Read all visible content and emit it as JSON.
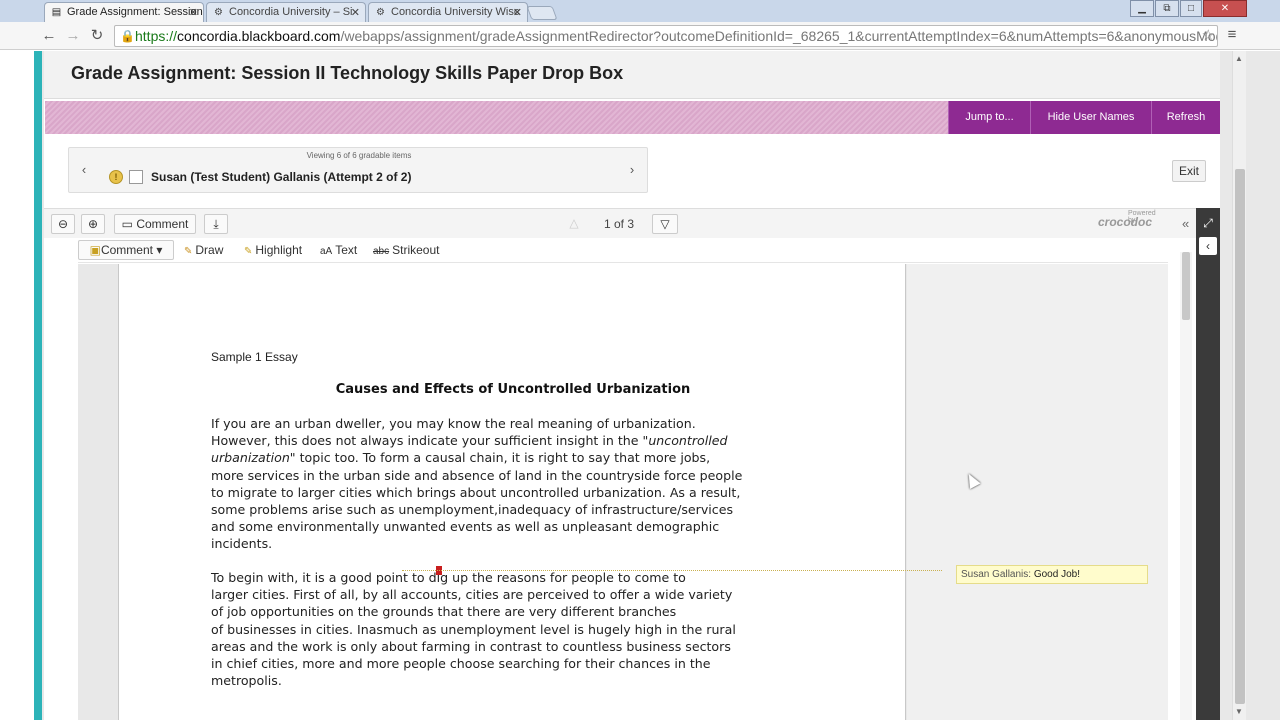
{
  "browser": {
    "tabs": [
      {
        "label": "Grade Assignment: Session",
        "active": true
      },
      {
        "label": "Concordia University – Si",
        "active": false
      },
      {
        "label": "Concordia University Wisc",
        "active": false
      }
    ],
    "url_scheme": "https://",
    "url_host": "concordia.blackboard.com",
    "url_path": "/webapps/assignment/gradeAssignmentRedirector?outcomeDefinitionId=_68265_1&currentAttemptIndex=6&numAttempts=6&anonymousMod"
  },
  "header": {
    "title": "Grade Assignment: Session II Technology Skills Paper Drop Box"
  },
  "actions": {
    "jump_to": "Jump to...",
    "hide_user_names": "Hide User Names",
    "refresh": "Refresh",
    "exit": "Exit"
  },
  "viewer": {
    "count_text": "Viewing 6 of 6 gradable items",
    "student": "Susan (Test Student) Gallanis (Attempt 2 of 2)"
  },
  "doc_toolbar": {
    "comment_label": "Comment",
    "page_indicator": "1 of 3",
    "powered_by": "Powered by",
    "brand": "crocodoc"
  },
  "annotations": {
    "comment": "Comment",
    "draw": "Draw",
    "highlight": "Highlight",
    "text": "Text",
    "strikeout": "Strikeout"
  },
  "essay": {
    "label": "Sample 1 Essay",
    "title": "Causes and Effects of Uncontrolled Urbanization",
    "p1_lines": [
      "  If you are an urban dweller, you may know the real meaning of urbanization.",
      "However, this does not always indicate your sufficient insight in the \"",
      "uncontrolled",
      "urbanization\"",
      " topic too. To form a causal chain, it is right to say that more jobs,",
      "more services in the urban side and absence of land in the countryside force people",
      "to migrate to larger cities which brings about uncontrolled urbanization. As a result,",
      "some problems arise such as unemployment,inadequacy of infrastructure/services",
      "and some environmentally unwanted events as well as unpleasant demographic",
      "incidents."
    ],
    "p2_lines": [
      "   To begin with, it is a good point to dig up the reasons for people to come to",
      "larger cities. First of all, by all accounts, cities are perceived to offer a wide variety",
      "of job opportunities on the grounds that there are very different branches",
      "of  businesses in cities. Inasmuch as unemployment level is hugely high in the rural",
      "areas and the work is only about farming in contrast to countless business sectors",
      "in chief cities, more and more people choose searching for their chances in the",
      "metropolis."
    ]
  },
  "comment_note": {
    "author": "Susan Gallanis:",
    "text": "Good Job!"
  }
}
